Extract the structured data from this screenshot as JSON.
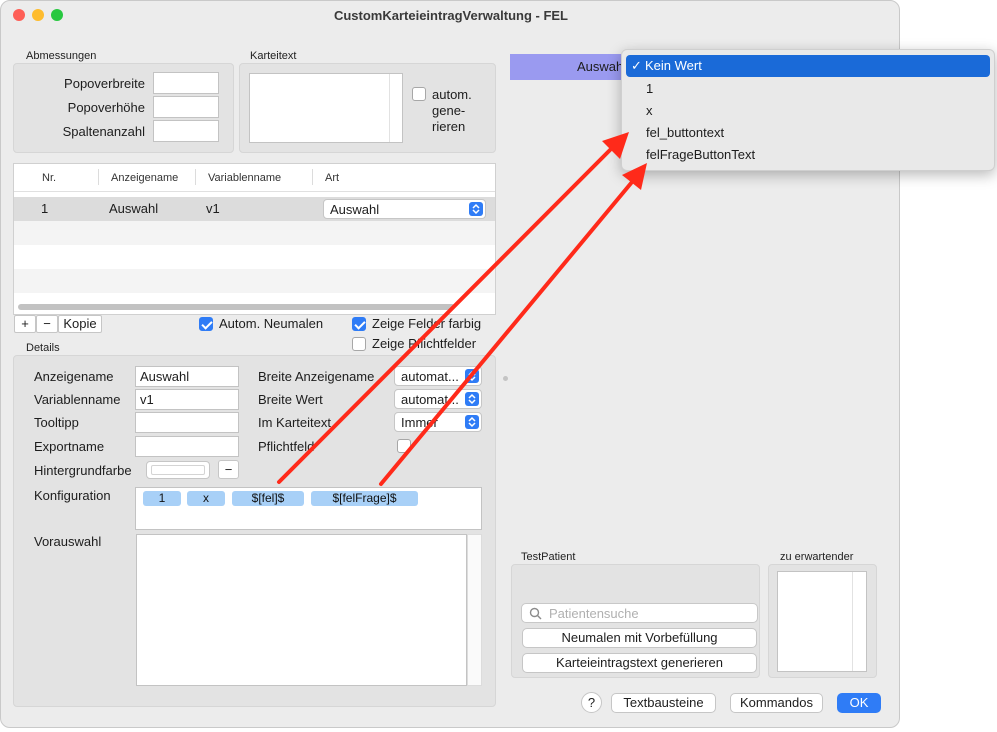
{
  "window": {
    "title": "CustomKarteieintragVerwaltung - FEL"
  },
  "dimensions": {
    "section_title": "Abmessungen",
    "width_label": "Popoverbreite",
    "height_label": "Popoverhöhe",
    "columns_label": "Spaltenanzahl",
    "width_value": "",
    "height_value": "",
    "columns_value": ""
  },
  "card_text": {
    "section_title": "Karteitext",
    "auto_label_1": "autom.",
    "auto_label_2": "gene-",
    "auto_label_3": "rieren",
    "auto_checked": false
  },
  "table": {
    "headers": [
      "Nr.",
      "Anzeigename",
      "Variablenname",
      "Art"
    ],
    "rows": [
      {
        "nr": "1",
        "display_name": "Auswahl",
        "var_name": "v1",
        "type": "Auswahl"
      }
    ]
  },
  "table_toolbar": {
    "add": "+",
    "remove": "−",
    "copy": "Kopie"
  },
  "options": {
    "auto_repaint": "Autom. Neumalen",
    "show_fields_colored": "Zeige Felder farbig",
    "show_required": "Zeige Pflichtfelder",
    "auto_repaint_checked": true,
    "show_fields_colored_checked": true,
    "show_required_checked": false
  },
  "details": {
    "section_title": "Details",
    "display_name_label": "Anzeigename",
    "display_name_value": "Auswahl",
    "var_name_label": "Variablenname",
    "var_name_value": "v1",
    "tooltip_label": "Tooltipp",
    "tooltip_value": "",
    "export_label": "Exportname",
    "export_value": "",
    "bg_color_label": "Hintergrundfarbe",
    "bg_color_minus": "−",
    "config_label": "Konfiguration",
    "config_tags": [
      "1",
      "x",
      "$[fel]$",
      "$[felFrage]$"
    ],
    "preselect_label": "Vorauswahl",
    "width_display_label": "Breite Anzeigename",
    "width_display_value": "automat...",
    "width_value_label": "Breite Wert",
    "width_value_value": "automat...",
    "in_card_label": "Im Karteitext",
    "in_card_value": "Immer",
    "required_label": "Pflichtfeld",
    "required_checked": false
  },
  "preview": {
    "label": "Auswahl"
  },
  "dropdown": {
    "selected": "Kein Wert",
    "items": [
      "1",
      "x",
      "fel_buttontext",
      "felFrageButtonText"
    ]
  },
  "test_patient": {
    "section_title": "TestPatient",
    "search_placeholder": "Patientensuche",
    "repaint_button": "Neumalen mit Vorbefüllung",
    "generate_button": "Karteieintragstext generieren"
  },
  "expected": {
    "section_title": "zu erwartender"
  },
  "footer": {
    "help": "?",
    "text_modules": "Textbausteine",
    "commands": "Kommandos",
    "ok": "OK"
  },
  "colors": {
    "accent": "#2f7cf6",
    "menu_highlight": "#1a6ad8",
    "preview_bar": "#9a9af0",
    "tag": "#a8d0f7",
    "arrow": "#ff2a1a"
  }
}
